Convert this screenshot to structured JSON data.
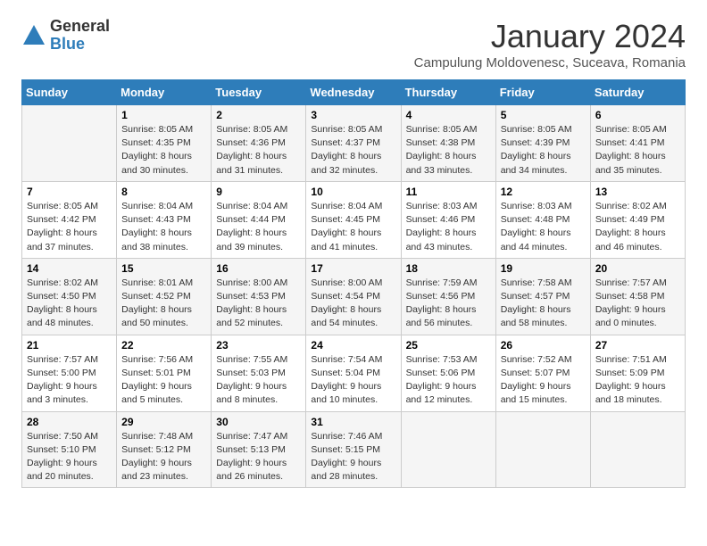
{
  "header": {
    "logo_general": "General",
    "logo_blue": "Blue",
    "title": "January 2024",
    "subtitle": "Campulung Moldovenesc, Suceava, Romania"
  },
  "weekdays": [
    "Sunday",
    "Monday",
    "Tuesday",
    "Wednesday",
    "Thursday",
    "Friday",
    "Saturday"
  ],
  "weeks": [
    [
      {
        "day": "",
        "sunrise": "",
        "sunset": "",
        "daylight": ""
      },
      {
        "day": "1",
        "sunrise": "Sunrise: 8:05 AM",
        "sunset": "Sunset: 4:35 PM",
        "daylight": "Daylight: 8 hours and 30 minutes."
      },
      {
        "day": "2",
        "sunrise": "Sunrise: 8:05 AM",
        "sunset": "Sunset: 4:36 PM",
        "daylight": "Daylight: 8 hours and 31 minutes."
      },
      {
        "day": "3",
        "sunrise": "Sunrise: 8:05 AM",
        "sunset": "Sunset: 4:37 PM",
        "daylight": "Daylight: 8 hours and 32 minutes."
      },
      {
        "day": "4",
        "sunrise": "Sunrise: 8:05 AM",
        "sunset": "Sunset: 4:38 PM",
        "daylight": "Daylight: 8 hours and 33 minutes."
      },
      {
        "day": "5",
        "sunrise": "Sunrise: 8:05 AM",
        "sunset": "Sunset: 4:39 PM",
        "daylight": "Daylight: 8 hours and 34 minutes."
      },
      {
        "day": "6",
        "sunrise": "Sunrise: 8:05 AM",
        "sunset": "Sunset: 4:41 PM",
        "daylight": "Daylight: 8 hours and 35 minutes."
      }
    ],
    [
      {
        "day": "7",
        "sunrise": "Sunrise: 8:05 AM",
        "sunset": "Sunset: 4:42 PM",
        "daylight": "Daylight: 8 hours and 37 minutes."
      },
      {
        "day": "8",
        "sunrise": "Sunrise: 8:04 AM",
        "sunset": "Sunset: 4:43 PM",
        "daylight": "Daylight: 8 hours and 38 minutes."
      },
      {
        "day": "9",
        "sunrise": "Sunrise: 8:04 AM",
        "sunset": "Sunset: 4:44 PM",
        "daylight": "Daylight: 8 hours and 39 minutes."
      },
      {
        "day": "10",
        "sunrise": "Sunrise: 8:04 AM",
        "sunset": "Sunset: 4:45 PM",
        "daylight": "Daylight: 8 hours and 41 minutes."
      },
      {
        "day": "11",
        "sunrise": "Sunrise: 8:03 AM",
        "sunset": "Sunset: 4:46 PM",
        "daylight": "Daylight: 8 hours and 43 minutes."
      },
      {
        "day": "12",
        "sunrise": "Sunrise: 8:03 AM",
        "sunset": "Sunset: 4:48 PM",
        "daylight": "Daylight: 8 hours and 44 minutes."
      },
      {
        "day": "13",
        "sunrise": "Sunrise: 8:02 AM",
        "sunset": "Sunset: 4:49 PM",
        "daylight": "Daylight: 8 hours and 46 minutes."
      }
    ],
    [
      {
        "day": "14",
        "sunrise": "Sunrise: 8:02 AM",
        "sunset": "Sunset: 4:50 PM",
        "daylight": "Daylight: 8 hours and 48 minutes."
      },
      {
        "day": "15",
        "sunrise": "Sunrise: 8:01 AM",
        "sunset": "Sunset: 4:52 PM",
        "daylight": "Daylight: 8 hours and 50 minutes."
      },
      {
        "day": "16",
        "sunrise": "Sunrise: 8:00 AM",
        "sunset": "Sunset: 4:53 PM",
        "daylight": "Daylight: 8 hours and 52 minutes."
      },
      {
        "day": "17",
        "sunrise": "Sunrise: 8:00 AM",
        "sunset": "Sunset: 4:54 PM",
        "daylight": "Daylight: 8 hours and 54 minutes."
      },
      {
        "day": "18",
        "sunrise": "Sunrise: 7:59 AM",
        "sunset": "Sunset: 4:56 PM",
        "daylight": "Daylight: 8 hours and 56 minutes."
      },
      {
        "day": "19",
        "sunrise": "Sunrise: 7:58 AM",
        "sunset": "Sunset: 4:57 PM",
        "daylight": "Daylight: 8 hours and 58 minutes."
      },
      {
        "day": "20",
        "sunrise": "Sunrise: 7:57 AM",
        "sunset": "Sunset: 4:58 PM",
        "daylight": "Daylight: 9 hours and 0 minutes."
      }
    ],
    [
      {
        "day": "21",
        "sunrise": "Sunrise: 7:57 AM",
        "sunset": "Sunset: 5:00 PM",
        "daylight": "Daylight: 9 hours and 3 minutes."
      },
      {
        "day": "22",
        "sunrise": "Sunrise: 7:56 AM",
        "sunset": "Sunset: 5:01 PM",
        "daylight": "Daylight: 9 hours and 5 minutes."
      },
      {
        "day": "23",
        "sunrise": "Sunrise: 7:55 AM",
        "sunset": "Sunset: 5:03 PM",
        "daylight": "Daylight: 9 hours and 8 minutes."
      },
      {
        "day": "24",
        "sunrise": "Sunrise: 7:54 AM",
        "sunset": "Sunset: 5:04 PM",
        "daylight": "Daylight: 9 hours and 10 minutes."
      },
      {
        "day": "25",
        "sunrise": "Sunrise: 7:53 AM",
        "sunset": "Sunset: 5:06 PM",
        "daylight": "Daylight: 9 hours and 12 minutes."
      },
      {
        "day": "26",
        "sunrise": "Sunrise: 7:52 AM",
        "sunset": "Sunset: 5:07 PM",
        "daylight": "Daylight: 9 hours and 15 minutes."
      },
      {
        "day": "27",
        "sunrise": "Sunrise: 7:51 AM",
        "sunset": "Sunset: 5:09 PM",
        "daylight": "Daylight: 9 hours and 18 minutes."
      }
    ],
    [
      {
        "day": "28",
        "sunrise": "Sunrise: 7:50 AM",
        "sunset": "Sunset: 5:10 PM",
        "daylight": "Daylight: 9 hours and 20 minutes."
      },
      {
        "day": "29",
        "sunrise": "Sunrise: 7:48 AM",
        "sunset": "Sunset: 5:12 PM",
        "daylight": "Daylight: 9 hours and 23 minutes."
      },
      {
        "day": "30",
        "sunrise": "Sunrise: 7:47 AM",
        "sunset": "Sunset: 5:13 PM",
        "daylight": "Daylight: 9 hours and 26 minutes."
      },
      {
        "day": "31",
        "sunrise": "Sunrise: 7:46 AM",
        "sunset": "Sunset: 5:15 PM",
        "daylight": "Daylight: 9 hours and 28 minutes."
      },
      {
        "day": "",
        "sunrise": "",
        "sunset": "",
        "daylight": ""
      },
      {
        "day": "",
        "sunrise": "",
        "sunset": "",
        "daylight": ""
      },
      {
        "day": "",
        "sunrise": "",
        "sunset": "",
        "daylight": ""
      }
    ]
  ]
}
